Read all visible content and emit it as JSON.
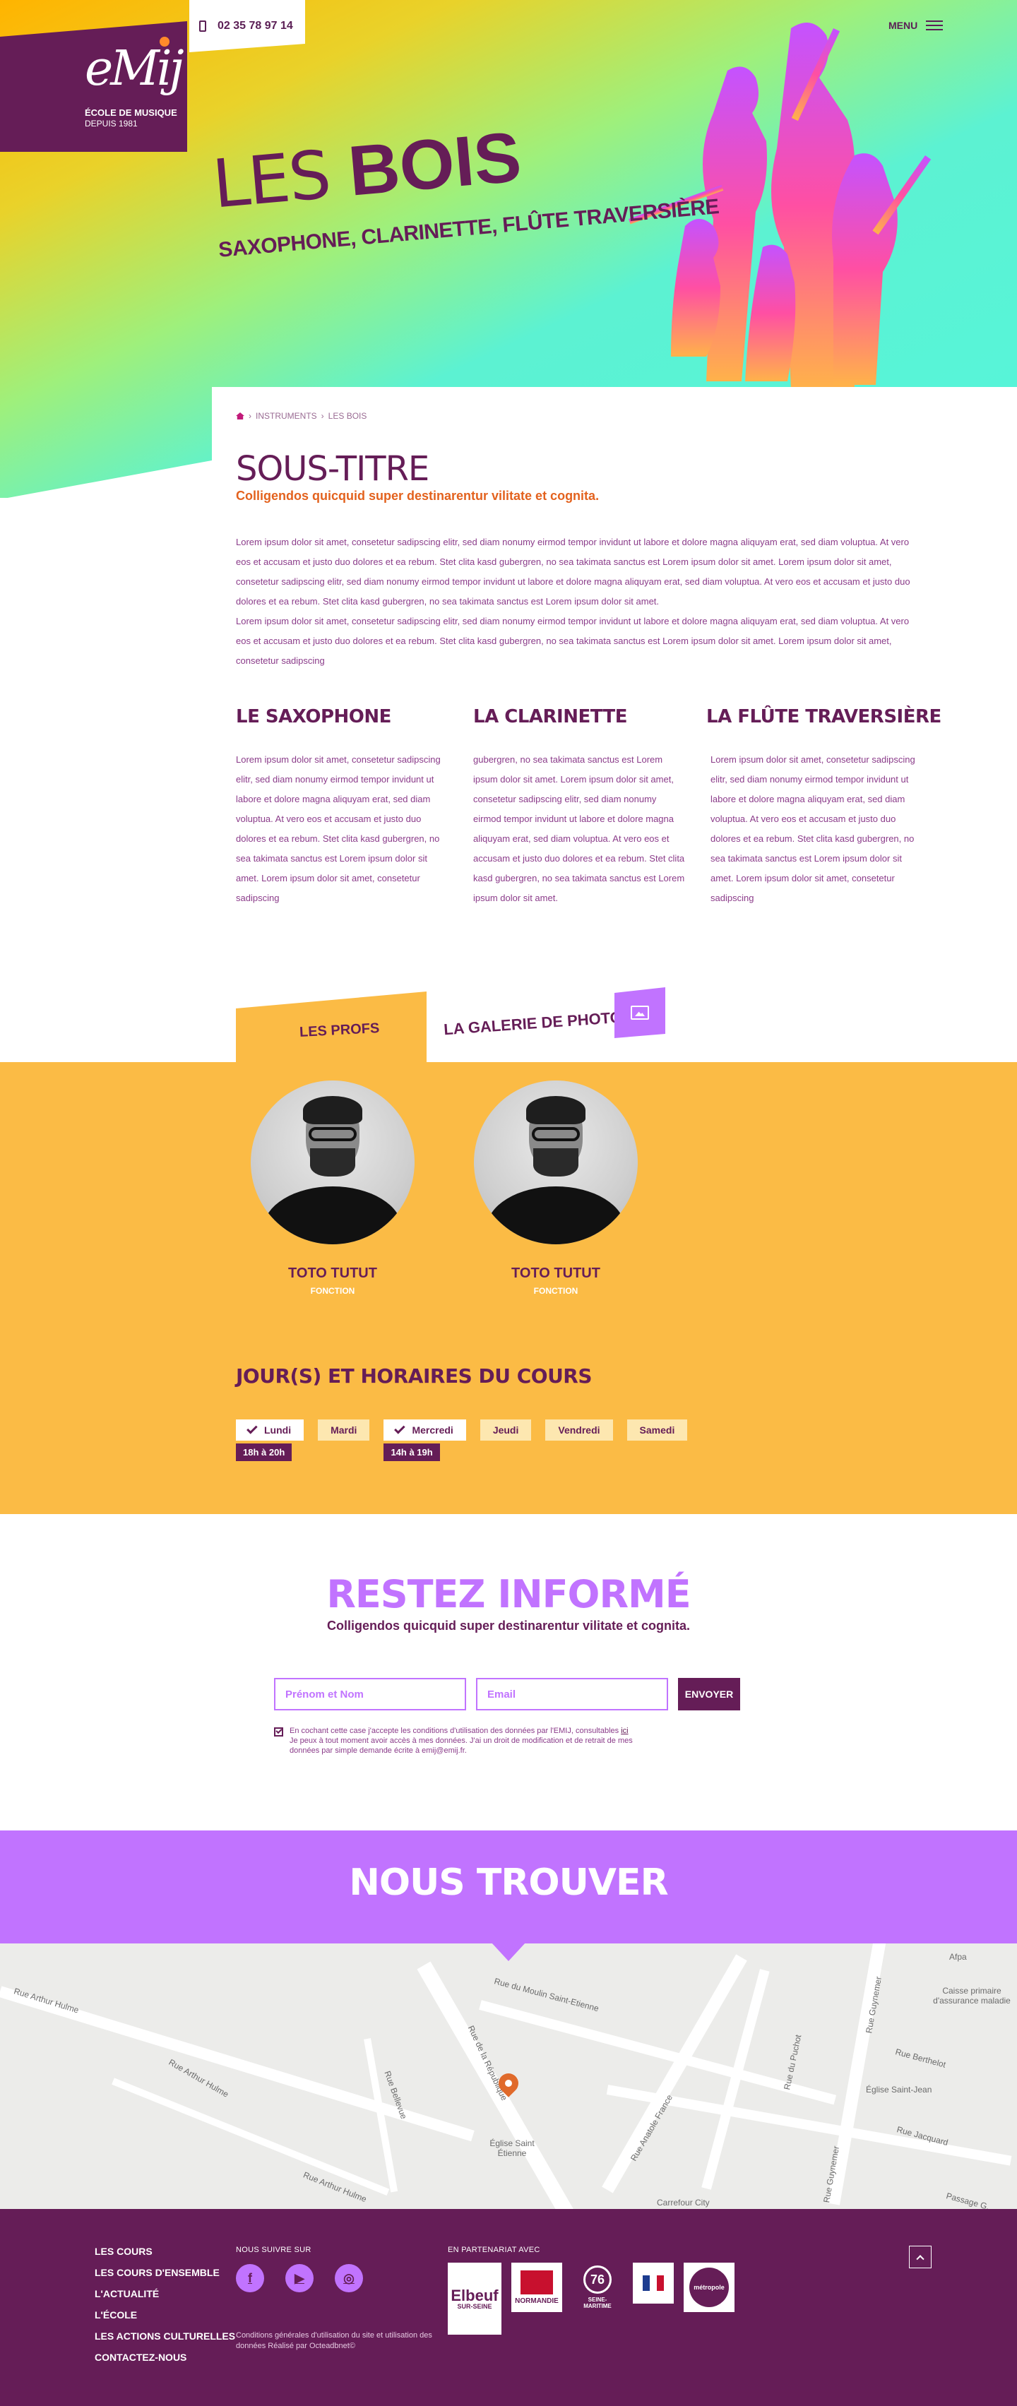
{
  "header": {
    "logo": {
      "mark": "eMij",
      "line1": "ÉCOLE DE MUSIQUE",
      "line2": "DEPUIS 1981"
    },
    "phone": "02 35 78 97 14",
    "menu_label": "MENU"
  },
  "hero": {
    "title_light": "LES",
    "title_bold": "BOIS",
    "subtitle": "SAXOPHONE, CLARINETTE, FLÛTE TRAVERSIÈRE"
  },
  "breadcrumb": {
    "items": [
      "INSTRUMENTS",
      "LES BOIS"
    ]
  },
  "intro": {
    "title": "SOUS-TITRE",
    "subtitle": "Colligendos quicquid super destinarentur vilitate et cognita.",
    "paragraph_1": "Lorem ipsum dolor sit amet, consetetur sadipscing elitr, sed diam nonumy eirmod tempor invidunt ut labore et dolore magna aliquyam erat, sed diam voluptua. At vero eos et accusam et justo duo dolores et ea rebum. Stet clita kasd gubergren, no sea takimata sanctus est Lorem ipsum dolor sit amet. Lorem ipsum dolor sit amet, consetetur sadipscing elitr, sed diam nonumy eirmod tempor invidunt ut labore et dolore magna aliquyam erat, sed diam voluptua. At vero eos et accusam et justo duo dolores et ea rebum. Stet clita kasd gubergren, no sea takimata sanctus est Lorem ipsum dolor sit amet.",
    "paragraph_2": "Lorem ipsum dolor sit amet, consetetur sadipscing elitr, sed diam nonumy eirmod tempor invidunt ut labore et dolore magna aliquyam erat, sed diam voluptua. At vero eos et accusam et justo duo dolores et ea rebum. Stet clita kasd gubergren, no sea takimata sanctus est Lorem ipsum dolor sit amet. Lorem ipsum dolor sit amet, consetetur sadipscing"
  },
  "instruments": [
    {
      "title": "LE SAXOPHONE",
      "text": "Lorem ipsum dolor sit amet, consetetur sadipscing elitr, sed diam nonumy eirmod tempor invidunt ut labore et dolore magna aliquyam erat, sed diam voluptua. At vero eos et accusam et justo duo dolores et ea rebum. Stet clita kasd gubergren, no sea takimata sanctus est Lorem ipsum dolor sit amet. Lorem ipsum dolor sit amet, consetetur sadipscing"
    },
    {
      "title": "LA CLARINETTE",
      "text": "gubergren, no sea takimata sanctus est Lorem ipsum dolor sit amet. Lorem ipsum dolor sit amet, consetetur sadipscing elitr, sed diam nonumy eirmod tempor invidunt ut labore et dolore magna aliquyam erat, sed diam voluptua. At vero eos et accusam et justo duo dolores et ea rebum. Stet clita kasd gubergren, no sea takimata sanctus est Lorem ipsum dolor sit amet."
    },
    {
      "title": "LA FLÛTE TRAVERSIÈRE",
      "text": "Lorem ipsum dolor sit amet, consetetur sadipscing elitr, sed diam nonumy eirmod tempor invidunt ut labore et dolore magna aliquyam erat, sed diam voluptua. At vero eos et accusam et justo duo dolores et ea rebum. Stet clita kasd gubergren, no sea takimata sanctus est Lorem ipsum dolor sit amet. Lorem ipsum dolor sit amet, consetetur sadipscing"
    }
  ],
  "tabs": {
    "profs": "LES PROFS",
    "gallery": "LA GALERIE DE PHOTOS"
  },
  "profs": [
    {
      "name": "TOTO TUTUT",
      "role": "FONCTION"
    },
    {
      "name": "TOTO TUTUT",
      "role": "FONCTION"
    }
  ],
  "schedule": {
    "title": "JOUR(S) ET HORAIRES DU COURS",
    "days": [
      {
        "label": "Lundi",
        "active": true,
        "hours": "18h à 20h"
      },
      {
        "label": "Mardi",
        "active": false,
        "hours": ""
      },
      {
        "label": "Mercredi",
        "active": true,
        "hours": "14h à 19h"
      },
      {
        "label": "Jeudi",
        "active": false,
        "hours": ""
      },
      {
        "label": "Vendredi",
        "active": false,
        "hours": ""
      },
      {
        "label": "Samedi",
        "active": false,
        "hours": ""
      }
    ]
  },
  "newsletter": {
    "title": "RESTEZ INFORMÉ",
    "subtitle": "Colligendos quicquid super destinarentur vilitate et cognita.",
    "name_placeholder": "Prénom et Nom",
    "email_placeholder": "Email",
    "button": "ENVOYER",
    "legal_1": "En cochant cette case j'accepte les conditions d'utilisation des données par l'EMIJ, consultables ",
    "legal_link": "ici",
    "legal_2": "Je peux à tout moment avoir accès à mes données. J'ai un droit de modification et de retrait de mes données par simple demande écrite à emij@emij.fr."
  },
  "location": {
    "title": "NOUS TROUVER",
    "map_labels": [
      "Rue Arthur Hulme",
      "Rue Arthur Hulme",
      "Rue Arthur Hulme",
      "Rue du Moulin Saint-Etienne",
      "Rue de la République",
      "Rue Bellevue",
      "Église Saint Étienne",
      "Rue Anatole France",
      "Rue du Puchot",
      "Rue Guynemer",
      "Rue Guynemer",
      "Rue Berthelot",
      "Église Saint-Jean",
      "Rue Jacquard",
      "Carrefour City",
      "Passage G...",
      "Afpa",
      "Caisse primaire d'assurance maladie"
    ]
  },
  "footer": {
    "links": [
      "LES COURS",
      "LES COURS D'ENSEMBLE",
      "L'ACTUALITÉ",
      "L'ÉCOLE",
      "LES ACTIONS CULTURELLES",
      "CONTACTEZ-NOUS"
    ],
    "follow_label": "NOUS SUIVRE SUR",
    "socials": [
      {
        "icon": "facebook-icon",
        "glyph": "f"
      },
      {
        "icon": "youtube-icon",
        "glyph": "▶"
      },
      {
        "icon": "instagram-icon",
        "glyph": "◎"
      }
    ],
    "legal": "Conditions générales d'utilisation du site et utilisation des données Réalisé par Octeadbnet©",
    "partners_label": "EN PARTENARIAT AVEC",
    "partners": [
      {
        "line1": "Elbeuf",
        "line2": "SUR-SEINE"
      },
      {
        "line1": "",
        "line2": "NORMANDIE"
      },
      {
        "line1": "76",
        "line2": "SEINE-MARITIME"
      },
      {
        "line1": "",
        "line2": ""
      },
      {
        "line1": "métropole",
        "line2": ""
      }
    ]
  }
}
